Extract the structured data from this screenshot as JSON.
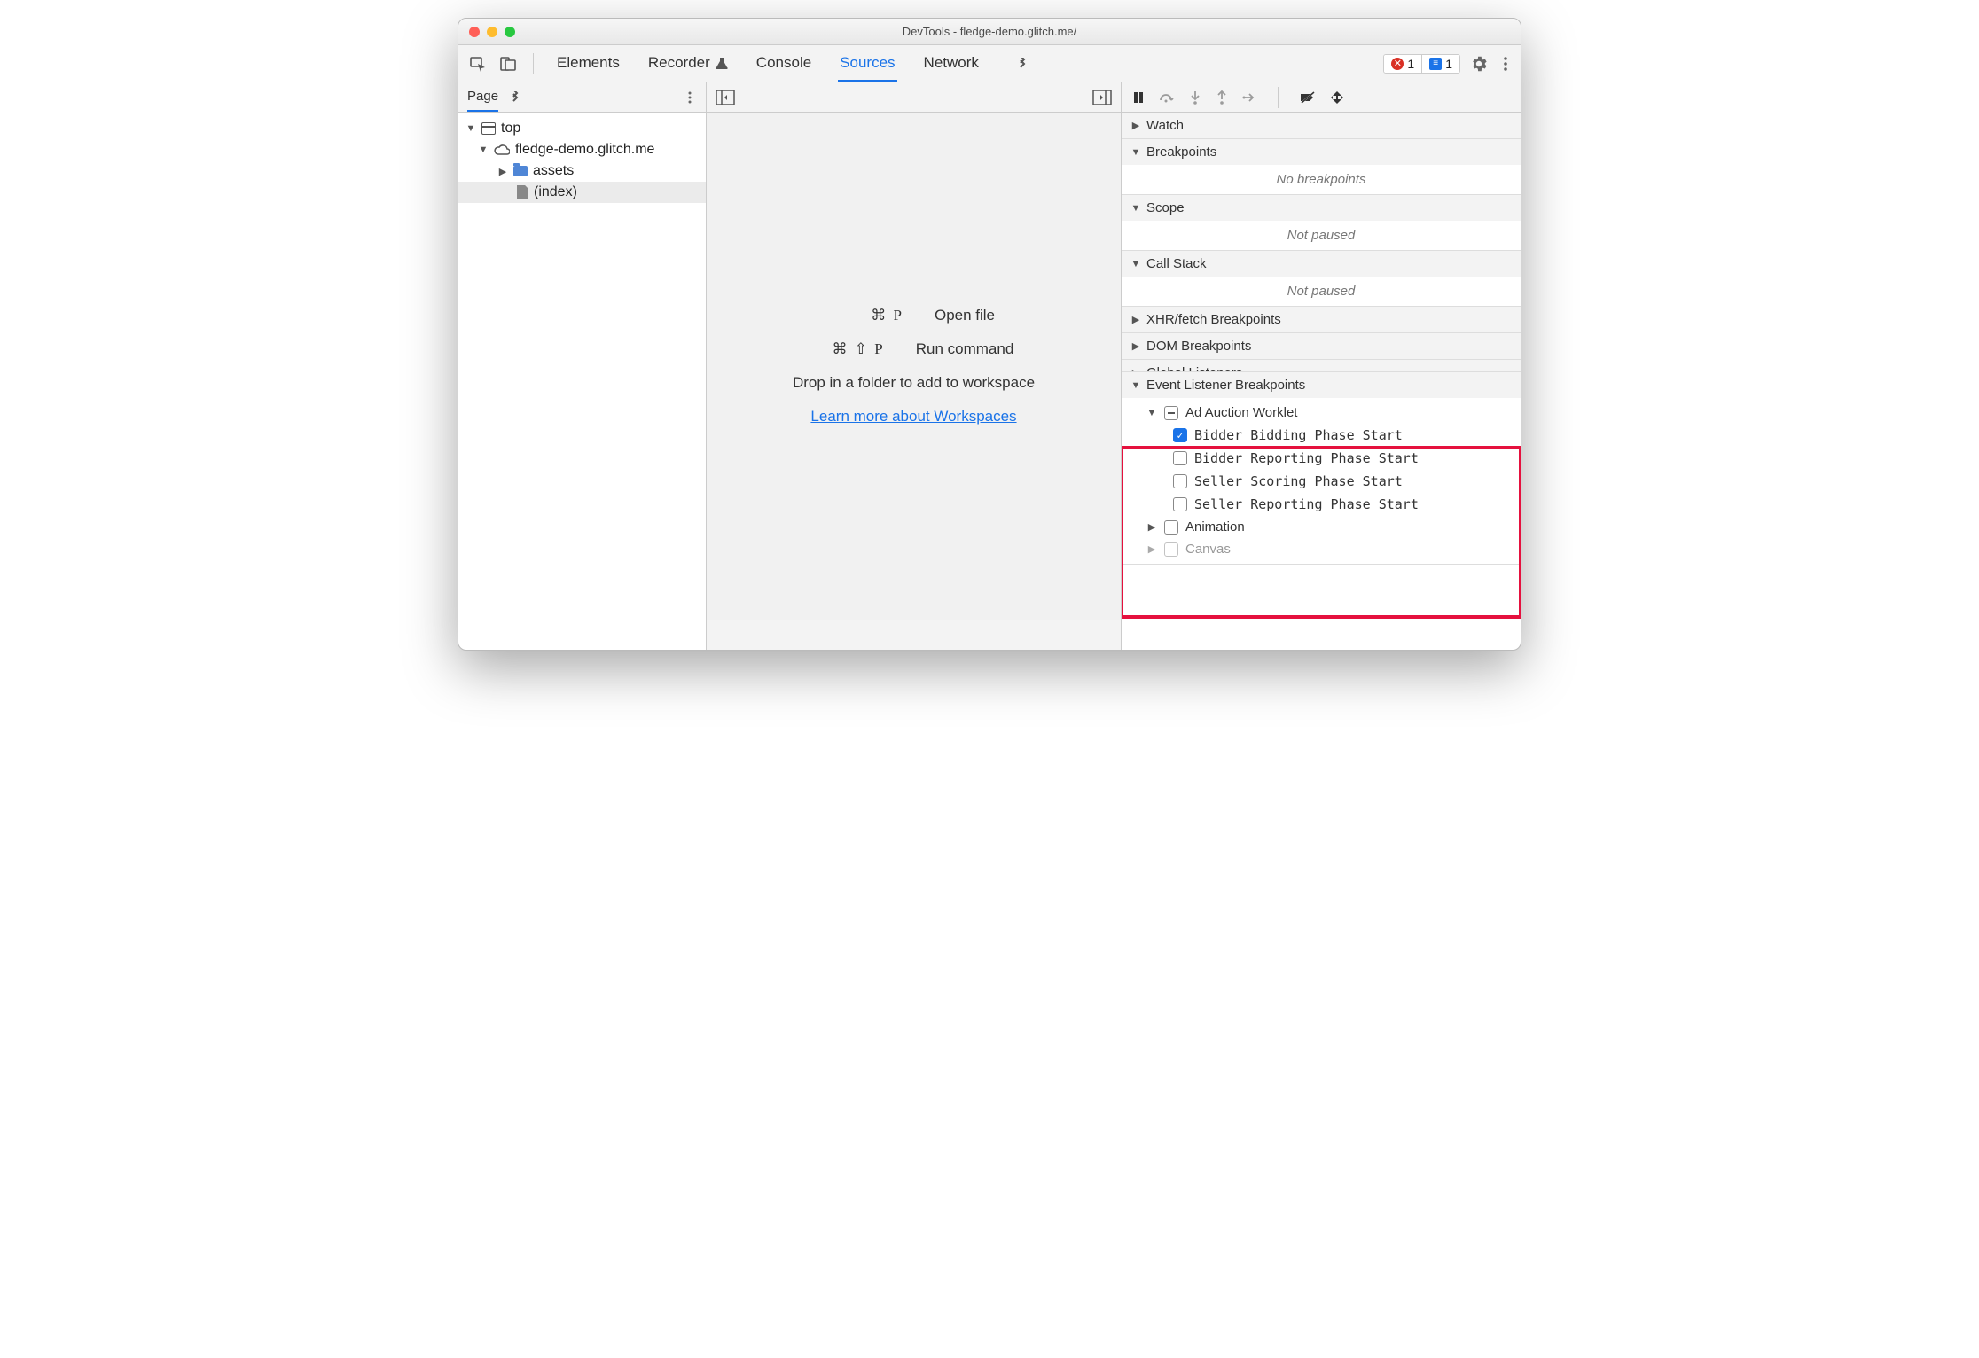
{
  "window_title": "DevTools - fledge-demo.glitch.me/",
  "tabs": {
    "elements": "Elements",
    "recorder": "Recorder",
    "console": "Console",
    "sources": "Sources",
    "network": "Network"
  },
  "badges": {
    "errors": "1",
    "messages": "1"
  },
  "left": {
    "tab": "Page",
    "tree": {
      "top": "top",
      "domain": "fledge-demo.glitch.me",
      "assets": "assets",
      "index": "(index)"
    }
  },
  "mid": {
    "open_file_keys": "⌘ P",
    "open_file_label": "Open file",
    "run_cmd_keys": "⌘ ⇧ P",
    "run_cmd_label": "Run command",
    "drop_text": "Drop in a folder to add to workspace",
    "learn_link": "Learn more about Workspaces"
  },
  "right": {
    "watch": "Watch",
    "breakpoints": "Breakpoints",
    "no_bp": "No breakpoints",
    "scope": "Scope",
    "not_paused1": "Not paused",
    "callstack": "Call Stack",
    "not_paused2": "Not paused",
    "xhr": "XHR/fetch Breakpoints",
    "dom": "DOM Breakpoints",
    "global": "Global Listeners",
    "elb": "Event Listener Breakpoints",
    "ad_auction": "Ad Auction Worklet",
    "bb": "Bidder Bidding Phase Start",
    "br": "Bidder Reporting Phase Start",
    "ss": "Seller Scoring Phase Start",
    "sr": "Seller Reporting Phase Start",
    "animation": "Animation",
    "canvas": "Canvas"
  }
}
